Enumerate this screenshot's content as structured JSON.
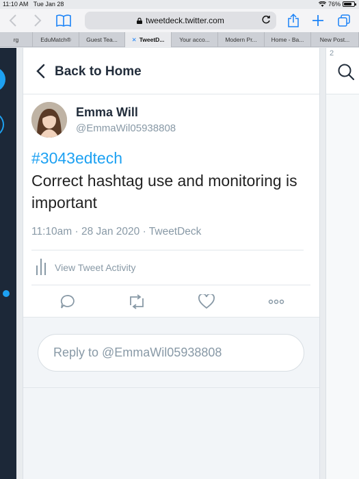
{
  "status_bar": {
    "time": "11:10 AM",
    "date": "Tue Jan 28",
    "battery": "76%",
    "battery_level": 0.76
  },
  "browser": {
    "url": "tweetdeck.twitter.com",
    "tabs": [
      {
        "label": "rg",
        "active": false
      },
      {
        "label": "EduMatch®",
        "active": false
      },
      {
        "label": "Guest Tea...",
        "active": false
      },
      {
        "label": "TweetD...",
        "active": true
      },
      {
        "label": "Your acco...",
        "active": false
      },
      {
        "label": "Modern Pr...",
        "active": false
      },
      {
        "label": "Home - Ba...",
        "active": false
      },
      {
        "label": "New Post...",
        "active": false
      }
    ]
  },
  "column": {
    "back_label": "Back to Home",
    "tweet": {
      "author_name": "Emma Will",
      "author_handle": "@EmmaWil05938808",
      "hashtag": "#3043edtech",
      "text": "Correct hashtag use and monitoring is important",
      "time": "11:10am",
      "date": "28 Jan 2020",
      "source": "TweetDeck",
      "meta": "11:10am · 28 Jan 2020 · TweetDeck",
      "activity_label": "View Tweet Activity"
    },
    "reply_placeholder": "Reply to @EmmaWil05938808"
  },
  "right_column": {
    "count": "2"
  },
  "colors": {
    "accent": "#1da1f2",
    "rail": "#1c2838",
    "text": "#222d3b",
    "muted": "#8899a6"
  },
  "icons": [
    "back-chevron-icon",
    "bar-chart-icon",
    "reply-icon",
    "retweet-icon",
    "like-icon",
    "more-icon",
    "search-icon",
    "share-icon",
    "add-tab-icon",
    "tabs-icon",
    "bookmarks-icon",
    "reload-icon",
    "lock-icon",
    "wifi-icon",
    "battery-icon"
  ]
}
